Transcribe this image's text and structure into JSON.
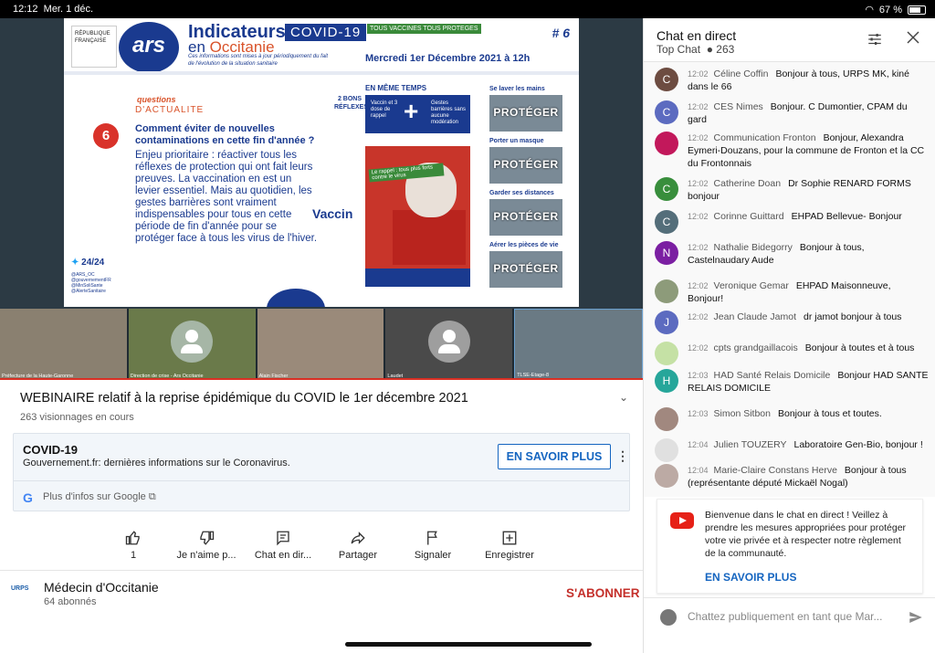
{
  "statusbar": {
    "time": "12:12",
    "date": "Mer. 1 déc.",
    "battery": "67 %"
  },
  "slide": {
    "rf_label": "RÉPUBLIQUE FRANÇAISE",
    "ars_logo": "ars",
    "title_line1": "Indicateurs",
    "title_line2_prefix": "en",
    "title_line2_region": "Occitanie",
    "covid_tag": "COVID-19",
    "vacc_tag": "TOUS VACCINES TOUS PROTEGES",
    "issue_number": "# 6",
    "subtitle": "Ces informations sont mises à jour périodiquement du fait de l'évolution de la situation sanitaire",
    "date": "Mercredi 1er Décembre 2021 à 12h",
    "question_label_1": "questions",
    "question_label_2": "D'ACTUALITE",
    "question_number": "6",
    "question_title": "Comment éviter de nouvelles contaminations en cette fin d'année ?",
    "question_body": "Enjeu prioritaire : réactiver tous les réflexes de protection qui ont fait leurs preuves. La vaccination en est un levier essentiel. Mais au quotidien, les gestes barrières sont vraiment indispensables pour tous en cette période de fin d'année pour se protéger face à tous les virus de l'hiver.",
    "twitter_label": "24/24",
    "handles": "@ARS_OC @gouvernementFR @MinSoliSante @AlerteSanitaire",
    "bons_reflexes": "2 BONS RÉFLEXES",
    "meme_temps": "EN MÊME TEMPS",
    "vacc_box_left": "Vaccin et 3 dose de rappel",
    "vacc_box_plus": "+",
    "vacc_box_right": "Gestes barrières sans aucune modération",
    "vaccin_logo": "Vaccin",
    "poster_tag": "Le rappel : tous plus forts contre le virus",
    "gestures": [
      {
        "label": "Se laver les mains",
        "stamp": "PROTÉGER"
      },
      {
        "label": "Porter un masque",
        "stamp": "PROTÉGER"
      },
      {
        "label": "Garder ses distances",
        "stamp": "PROTÉGER"
      },
      {
        "label": "Aérer les pièces de vie",
        "stamp": "PROTÉGER"
      }
    ]
  },
  "thumbs": [
    {
      "caption": "Préfecture de la Haute-Garonne"
    },
    {
      "caption": "Direction de crise - Ars Occitanie"
    },
    {
      "caption": "Alain Fischer"
    },
    {
      "caption": "Laudet"
    },
    {
      "caption": "TLSE-Etage-8"
    }
  ],
  "video": {
    "title": "WEBINAIRE relatif à la reprise épidémique du COVID le 1er décembre 2021",
    "views": "263 visionnages en cours"
  },
  "info_card": {
    "heading": "COVID-19",
    "source": "Gouvernement.fr: dernières informations sur le Coronavirus.",
    "button": "EN SAVOIR PLUS",
    "google": "G",
    "more": "Plus d'infos sur Google"
  },
  "actions": [
    {
      "label": "1",
      "icon": "like-icon"
    },
    {
      "label": "Je n'aime p...",
      "icon": "dislike-icon"
    },
    {
      "label": "Chat en dir...",
      "icon": "chat-icon"
    },
    {
      "label": "Partager",
      "icon": "share-icon"
    },
    {
      "label": "Signaler",
      "icon": "flag-icon"
    },
    {
      "label": "Enregistrer",
      "icon": "add-playlist-icon"
    }
  ],
  "channel": {
    "logo": "URPS",
    "name": "Médecin d'Occitanie",
    "subs": "64 abonnés",
    "subscribe": "S'ABONNER"
  },
  "chat": {
    "title": "Chat en direct",
    "mode": "Top Chat",
    "viewers": "263",
    "messages": [
      {
        "initial": "C",
        "color": "#6d4c41",
        "time": "12:02",
        "author": "Céline Coffin",
        "text": "Bonjour à tous, URPS MK, kiné dans le 66"
      },
      {
        "initial": "C",
        "color": "#5c6bc0",
        "time": "12:02",
        "author": "CES Nimes",
        "text": "Bonjour. C Dumontier, CPAM du gard"
      },
      {
        "initial": "",
        "color": "#c2185b",
        "time": "12:02",
        "author": "Communication Fronton",
        "text": "Bonjour, Alexandra Eymeri-Douzans, pour la commune de Fronton et la CC du Frontonnais"
      },
      {
        "initial": "C",
        "color": "#388e3c",
        "time": "12:02",
        "author": "Catherine Doan",
        "text": "Dr Sophie RENARD FORMS bonjour"
      },
      {
        "initial": "C",
        "color": "#546e7a",
        "time": "12:02",
        "author": "Corinne Guittard",
        "text": "EHPAD Bellevue- Bonjour"
      },
      {
        "initial": "N",
        "color": "#7b1fa2",
        "time": "12:02",
        "author": "Nathalie Bidegorry",
        "text": "Bonjour à tous, Castelnaudary Aude"
      },
      {
        "initial": "",
        "color": "#8d9b7a",
        "time": "12:02",
        "author": "Veronique Gemar",
        "text": "EHPAD Maisonneuve, Bonjour!"
      },
      {
        "initial": "J",
        "color": "#5c6bc0",
        "time": "12:02",
        "author": "Jean Claude Jamot",
        "text": "dr jamot bonjour à tous"
      },
      {
        "initial": "",
        "color": "#c5e1a5",
        "time": "12:02",
        "author": "cpts grandgaillacois",
        "text": "Bonjour à toutes et à tous"
      },
      {
        "initial": "H",
        "color": "#26a69a",
        "time": "12:03",
        "author": "HAD Santé Relais Domicile",
        "text": "Bonjour HAD SANTE RELAIS DOMICILE"
      },
      {
        "initial": "",
        "color": "#a1887f",
        "time": "12:03",
        "author": "Simon Sitbon",
        "text": "Bonjour à tous et toutes."
      },
      {
        "initial": "",
        "color": "#e0e0e0",
        "time": "12:04",
        "author": "Julien TOUZERY",
        "text": "Laboratoire Gen-Bio, bonjour !"
      },
      {
        "initial": "",
        "color": "#bcaaa4",
        "time": "12:04",
        "author": "Marie-Claire Constans Herve",
        "text": "Bonjour à tous (représentante député Mickaël Nogal)"
      }
    ],
    "notice": "Bienvenue dans le chat en direct ! Veillez à prendre les mesures appropriées pour protéger votre vie privée et à respecter notre règlement de la communauté.",
    "notice_link": "EN SAVOIR PLUS",
    "input_placeholder": "Chattez publiquement en tant que Mar..."
  }
}
